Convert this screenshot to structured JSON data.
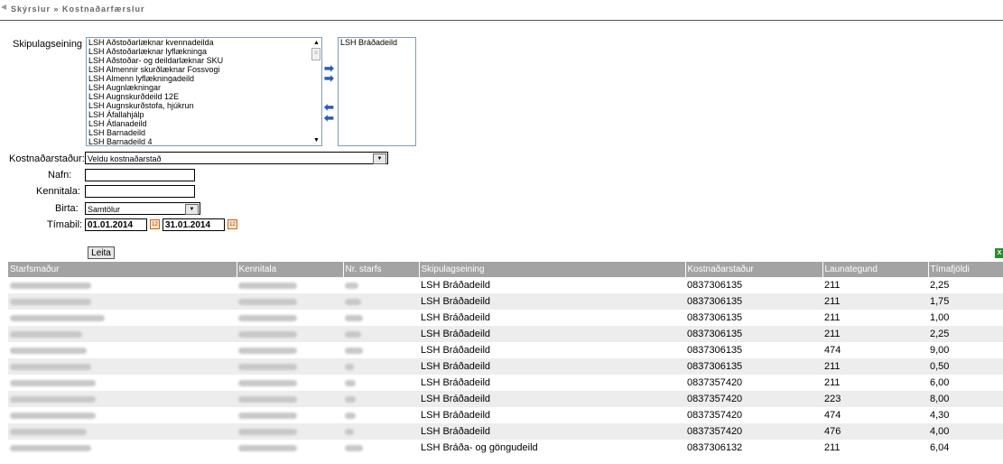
{
  "header": {
    "breadcrumb": "Skýrslur » Kostnaðarfærslur"
  },
  "form": {
    "org_unit_label": "Skipulagseining",
    "org_unit_options": [
      "LSH Aðstoðarlæknar kvennadeilda",
      "LSH Aðstoðarlæknar lyflækninga",
      "LSH Aðstoðar- og deildarlæknar SKU",
      "LSH Almennir skurðlæknar Fossvogi",
      "LSH Almenn lyflækningadeild",
      "LSH Augnlækningar",
      "LSH Augnskurðdeild 12E",
      "LSH Augnskurðstofa, hjúkrun",
      "LSH Áfallahjálp",
      "LSH Átlanadeild",
      "LSH Barnadeild",
      "LSH Barnadeild 4"
    ],
    "selected_units": [
      "LSH Bráðadeild"
    ],
    "cost_center_label": "Kostnaðarstaður:",
    "cost_center_value": "Veldu kostnaðarstað",
    "name_label": "Nafn:",
    "name_value": "",
    "kennitala_label": "Kennitala:",
    "kennitala_value": "",
    "show_label": "Birta:",
    "show_value": "Samtölur",
    "period_label": "Tímabil:",
    "date_from": "01.01.2014",
    "date_to": "31.01.2014",
    "search_button": "Leita"
  },
  "table": {
    "headers": [
      "Starfsmaður",
      "Kennitala",
      "Nr. starfs",
      "Skipulagseining",
      "Kostnaðarstaður",
      "Launategund",
      "Tímafjöldi"
    ],
    "rows": [
      [
        "LSH Bráðadeild",
        "0837306135",
        "211",
        "2,25"
      ],
      [
        "LSH Bráðadeild",
        "0837306135",
        "211",
        "1,75"
      ],
      [
        "LSH Bráðadeild",
        "0837306135",
        "211",
        "1,00"
      ],
      [
        "LSH Bráðadeild",
        "0837306135",
        "211",
        "2,25"
      ],
      [
        "LSH Bráðadeild",
        "0837306135",
        "474",
        "9,00"
      ],
      [
        "LSH Bráðadeild",
        "0837306135",
        "211",
        "0,50"
      ],
      [
        "LSH Bráðadeild",
        "0837357420",
        "211",
        "6,00"
      ],
      [
        "LSH Bráðadeild",
        "0837357420",
        "223",
        "8,00"
      ],
      [
        "LSH Bráðadeild",
        "0837357420",
        "474",
        "4,30"
      ],
      [
        "LSH Bráðadeild",
        "0837357420",
        "476",
        "4,00"
      ],
      [
        "LSH Bráða- og göngudeild",
        "0837306132",
        "211",
        "6,04"
      ]
    ]
  },
  "colors": {
    "header_bg": "#a3a3a3",
    "row_alt": "#ededed",
    "move_arrow": "#2a5cba"
  }
}
